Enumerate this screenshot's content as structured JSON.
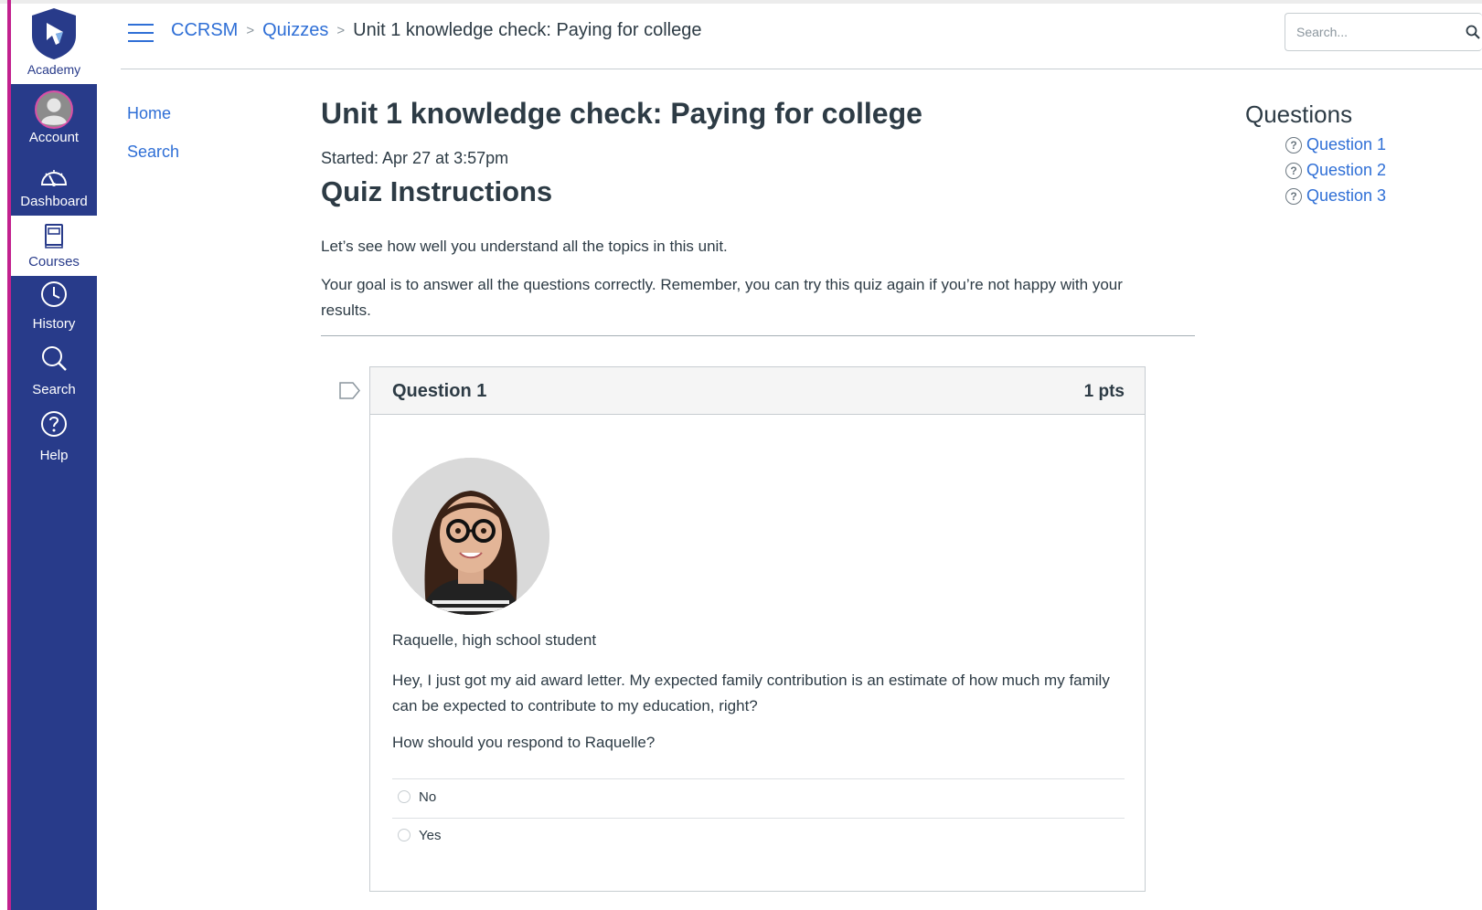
{
  "global_nav": {
    "logo_label": "Academy",
    "items": [
      {
        "label": "Account",
        "icon": "account-avatar-icon"
      },
      {
        "label": "Dashboard",
        "icon": "dashboard-icon"
      },
      {
        "label": "Courses",
        "icon": "courses-icon",
        "active": true
      },
      {
        "label": "History",
        "icon": "history-clock-icon"
      },
      {
        "label": "Search",
        "icon": "search-icon"
      },
      {
        "label": "Help",
        "icon": "help-icon"
      }
    ],
    "colors": {
      "nav_bg": "#283b8a",
      "accent": "#c2218e"
    }
  },
  "header": {
    "breadcrumbs": [
      "CCRSM",
      "Quizzes",
      "Unit 1 knowledge check: Paying for college"
    ],
    "search_placeholder": "Search..."
  },
  "course_nav": [
    "Home",
    "Search"
  ],
  "main": {
    "title": "Unit 1 knowledge check: Paying for college",
    "started": "Started: Apr 27 at 3:57pm",
    "instructions_heading": "Quiz Instructions",
    "paragraph1": "Let’s see how well you understand all the topics in this unit.",
    "paragraph2": "Your goal is to answer all the questions correctly. Remember, you can try this quiz again if you’re not happy with your results."
  },
  "question": {
    "name": "Question 1",
    "points": "1 pts",
    "person": "Raquelle, high school student",
    "text": "Hey, I just got my aid award letter. My expected family contribution is an estimate of how much my family can be expected to contribute to my education, right?",
    "ask": "How should you respond to Raquelle?",
    "options": [
      "No",
      "Yes"
    ]
  },
  "questions_sidebar": {
    "title": "Questions",
    "items": [
      "Question 1",
      "Question 2",
      "Question 3"
    ]
  },
  "link_color": "#2f6fd6"
}
